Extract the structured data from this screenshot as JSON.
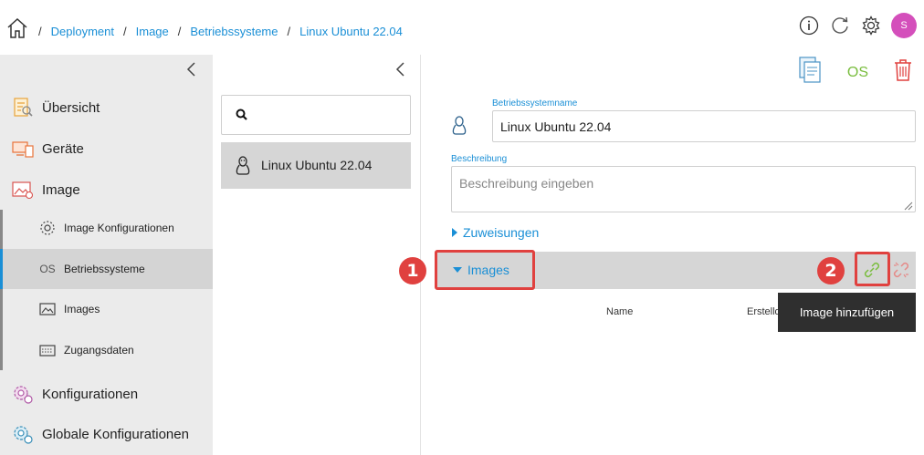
{
  "breadcrumb": {
    "items": [
      "Deployment",
      "Image",
      "Betriebssysteme",
      "Linux Ubuntu 22.04"
    ],
    "separator": "/"
  },
  "header": {
    "avatar_initial": "S",
    "icons": [
      "info-icon",
      "refresh-icon",
      "gear-icon"
    ]
  },
  "sidebar": {
    "items": [
      {
        "label": "Übersicht",
        "icon": "overview-icon"
      },
      {
        "label": "Geräte",
        "icon": "devices-icon"
      },
      {
        "label": "Image",
        "icon": "image-icon"
      },
      {
        "label": "Konfigurationen",
        "icon": "configurations-icon"
      },
      {
        "label": "Globale Konfigurationen",
        "icon": "global-configurations-icon"
      }
    ],
    "subitems": [
      {
        "label": "Image Konfigurationen",
        "icon": "image-config-icon"
      },
      {
        "label": "Betriebssysteme",
        "icon_text": "OS",
        "active": true
      },
      {
        "label": "Images",
        "icon": "images-icon"
      },
      {
        "label": "Zugangsdaten",
        "icon": "credentials-icon"
      }
    ]
  },
  "list": {
    "search_placeholder": "",
    "items": [
      {
        "label": "Linux Ubuntu 22.04",
        "icon": "linux-icon"
      }
    ]
  },
  "toolbar": {
    "os_label": "OS"
  },
  "detail": {
    "name_label": "Betriebssystemname",
    "name_value": "Linux Ubuntu 22.04",
    "description_label": "Beschreibung",
    "description_placeholder": "Beschreibung eingeben",
    "assignments_label": "Zuweisungen",
    "images_label": "Images",
    "columns": [
      "Name",
      "Erstelldatum"
    ],
    "tooltip": "Image hinzufügen"
  },
  "annotations": {
    "badge_1": "1",
    "badge_2": "2",
    "color": "#e0413f"
  },
  "colors": {
    "accent": "#1a8fd6",
    "green": "#79bd3e",
    "red": "#e0413f",
    "sidebar_bg": "#ebebeb",
    "selected_bg": "#d6d6d6"
  }
}
